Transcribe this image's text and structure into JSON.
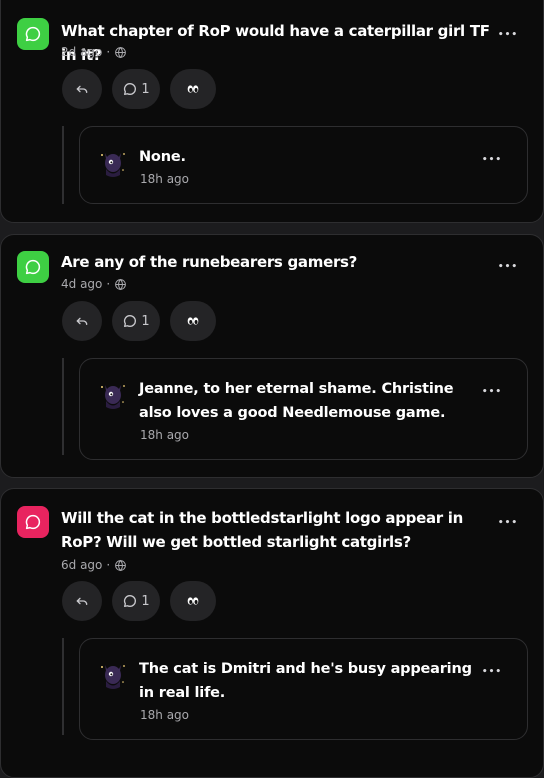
{
  "colors": {
    "green_badge": "#3ecf43",
    "pink_badge": "#e8245f",
    "card_bg": "#0b0b0b",
    "button_bg": "#242426"
  },
  "posts": [
    {
      "question": "What chapter of RoP would have a caterpillar girl TF in it?",
      "time": "2d ago",
      "comment_count": "1",
      "badge_color": "green",
      "answer": {
        "text": "None.",
        "time": "18h ago"
      }
    },
    {
      "question": "Are any of the runebearers gamers?",
      "time": "4d ago",
      "comment_count": "1",
      "badge_color": "green",
      "answer": {
        "text": "Jeanne, to her eternal shame. Christine also loves a good Needlemouse game.",
        "time": "18h ago"
      }
    },
    {
      "question": "Will the cat in the bottledstarlight logo appear in RoP? Will we get bottled starlight catgirls?",
      "time": "6d ago",
      "comment_count": "1",
      "badge_color": "pink",
      "answer": {
        "text": "The cat is Dmitri and he's busy appearing in real life.",
        "time": "18h ago"
      }
    }
  ],
  "icons": {
    "badge": "speech-bubble-icon",
    "visibility": "globe-icon",
    "reply": "reply-arrow-icon",
    "comments": "comment-bubble-icon",
    "react": "eyes-emoji-icon",
    "menu": "more-horizontal-icon"
  },
  "meta_separator": "·",
  "more_glyph": "•••"
}
